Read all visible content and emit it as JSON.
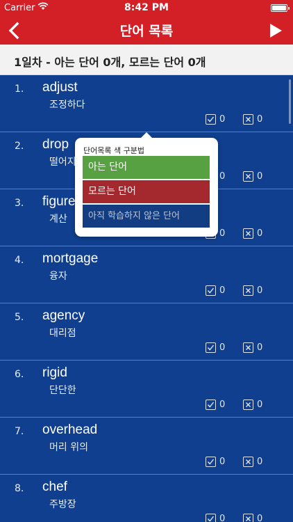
{
  "status_bar": {
    "carrier": "Carrier",
    "time": "8:42 PM"
  },
  "nav": {
    "title": "단어 목록",
    "back_icon": "chevron-left-icon",
    "play_icon": "play-icon"
  },
  "summary": "1일차 - 아는 단어 0개, 모르는 단어 0개",
  "colors": {
    "nav_bg": "#d31f26",
    "list_bg": "#0f3f8e",
    "known": "#57a142",
    "unknown": "#a3292e",
    "unstudied": "#133d83"
  },
  "words": [
    {
      "num": "1.",
      "word": "adjust",
      "meaning": "조정하다",
      "known": "0",
      "unknown": "0"
    },
    {
      "num": "2.",
      "word": "drop",
      "meaning": "떨어지",
      "known": "0",
      "unknown": "0"
    },
    {
      "num": "3.",
      "word": "figure",
      "meaning": "계산",
      "known": "0",
      "unknown": "0"
    },
    {
      "num": "4.",
      "word": "mortgage",
      "meaning": "융자",
      "known": "0",
      "unknown": "0"
    },
    {
      "num": "5.",
      "word": "agency",
      "meaning": "대리점",
      "known": "0",
      "unknown": "0"
    },
    {
      "num": "6.",
      "word": "rigid",
      "meaning": "단단한",
      "known": "0",
      "unknown": "0"
    },
    {
      "num": "7.",
      "word": "overhead",
      "meaning": "머리 위의",
      "known": "0",
      "unknown": "0"
    },
    {
      "num": "8.",
      "word": "chef",
      "meaning": "주방장",
      "known": "0",
      "unknown": "0"
    }
  ],
  "popover": {
    "title": "단어목록 색 구분법",
    "known": "아는 단어",
    "unknown": "모르는 단어",
    "unstudied": "아직 학습하지 않은 단어"
  }
}
